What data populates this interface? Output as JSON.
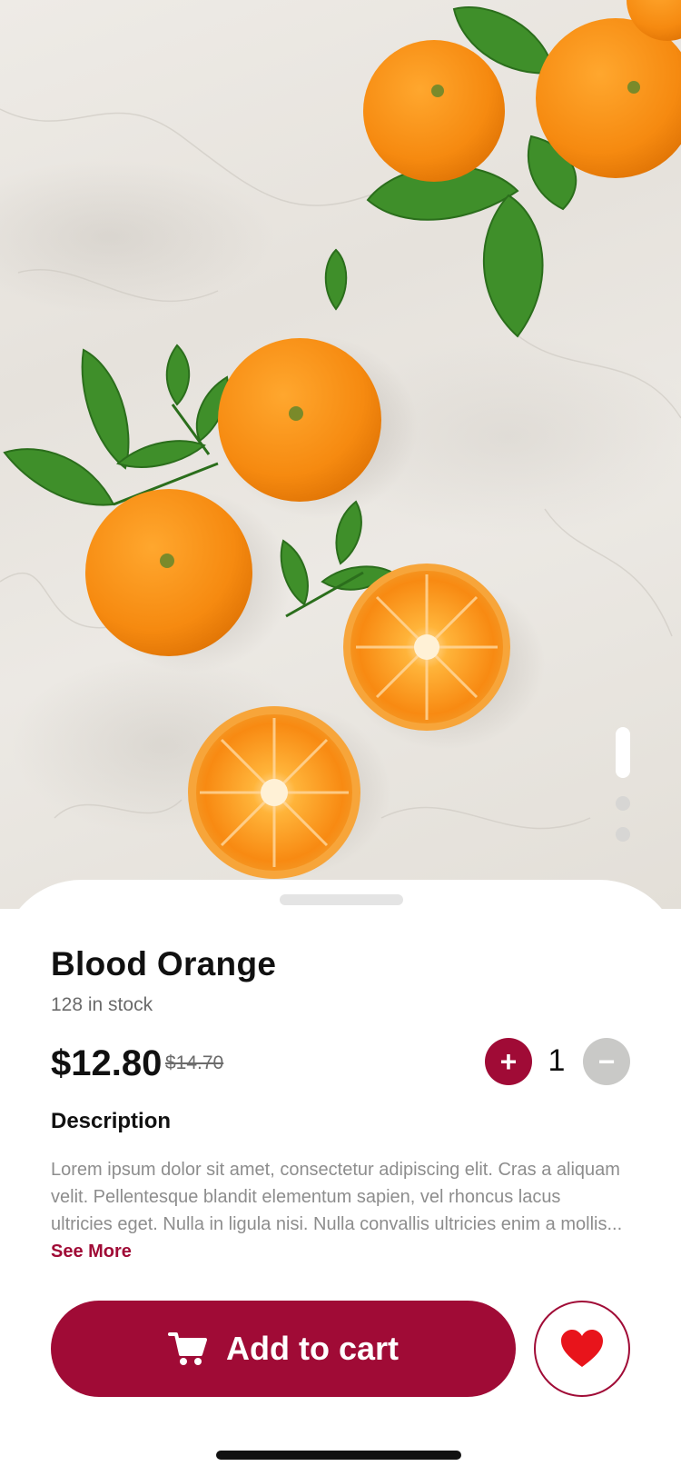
{
  "product": {
    "name": "Blood Orange",
    "stock_text": "128 in stock",
    "price": "$12.80",
    "original_price": "$14.70"
  },
  "quantity": {
    "increment_symbol": "+",
    "value": "1",
    "decrement_symbol": "−"
  },
  "description": {
    "heading": "Description",
    "text": "Lorem ipsum dolor sit amet, consectetur adipiscing elit. Cras a aliquam velit. Pellentesque blandit elementum sapien, vel rhoncus lacus ultricies eget. Nulla in ligula nisi. Nulla convallis ultricies enim a mollis...",
    "see_more": "See More"
  },
  "actions": {
    "add_to_cart": "Add to cart",
    "cart_icon": "cart-icon",
    "favorite_icon": "heart-icon"
  },
  "gallery": {
    "active_index": 0,
    "page_count": 3
  },
  "colors": {
    "accent": "#a00b36",
    "favorite": "#e8141b",
    "disabled": "#c9c9c7"
  }
}
